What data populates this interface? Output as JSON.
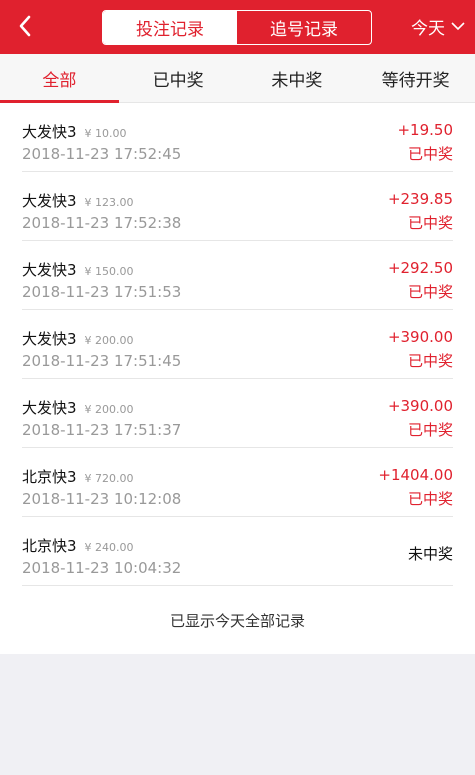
{
  "header": {
    "segments": [
      "投注记录",
      "追号记录"
    ],
    "day_filter": "今天"
  },
  "tabs": [
    "全部",
    "已中奖",
    "未中奖",
    "等待开奖"
  ],
  "records": [
    {
      "name": "大发快3",
      "amount": "¥ 10.00",
      "time": "2018-11-23 17:52:45",
      "profit": "+19.50",
      "status": "已中奖"
    },
    {
      "name": "大发快3",
      "amount": "¥ 123.00",
      "time": "2018-11-23 17:52:38",
      "profit": "+239.85",
      "status": "已中奖"
    },
    {
      "name": "大发快3",
      "amount": "¥ 150.00",
      "time": "2018-11-23 17:51:53",
      "profit": "+292.50",
      "status": "已中奖"
    },
    {
      "name": "大发快3",
      "amount": "¥ 200.00",
      "time": "2018-11-23 17:51:45",
      "profit": "+390.00",
      "status": "已中奖"
    },
    {
      "name": "大发快3",
      "amount": "¥ 200.00",
      "time": "2018-11-23 17:51:37",
      "profit": "+390.00",
      "status": "已中奖"
    },
    {
      "name": "北京快3",
      "amount": "¥ 720.00",
      "time": "2018-11-23 10:12:08",
      "profit": "+1404.00",
      "status": "已中奖"
    },
    {
      "name": "北京快3",
      "amount": "¥ 240.00",
      "time": "2018-11-23 10:04:32",
      "profit": "",
      "status": "未中奖"
    }
  ],
  "footer_text": "已显示今天全部记录",
  "colors": {
    "accent": "#e0212e",
    "muted": "#999999"
  }
}
